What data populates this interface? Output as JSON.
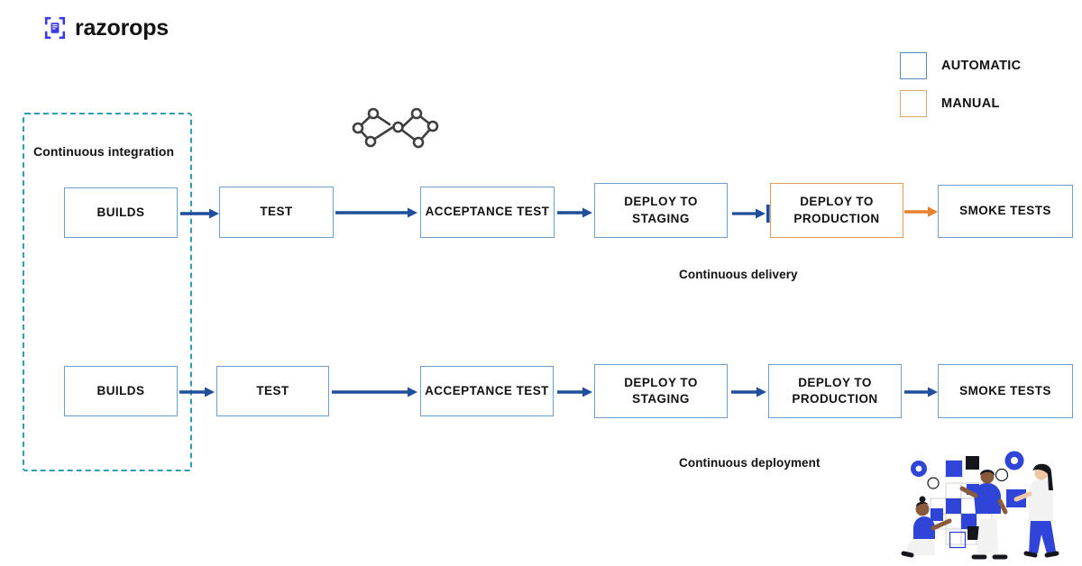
{
  "brand": {
    "name": "razorops",
    "logo_icon": "razorops-bracket-logo",
    "logo_color": "#3b38e8"
  },
  "legend": {
    "items": [
      {
        "label": "AUTOMATIC",
        "color": "#5b87bb",
        "kind": "auto"
      },
      {
        "label": "MANUAL",
        "color": "#dda96f",
        "kind": "manual"
      }
    ]
  },
  "ci_group": {
    "label": "Continuous integration",
    "border_color": "#2e9fb0",
    "style": "dashed"
  },
  "devops_symbol": {
    "icon": "devops-infinity-nodes-icon",
    "color": "#3f3f3f"
  },
  "pipelines": [
    {
      "caption": "Continuous delivery",
      "stages": [
        {
          "label": "BUILDS",
          "kind": "auto"
        },
        {
          "label": "TEST",
          "kind": "auto"
        },
        {
          "label": "ACCEPTANCE TEST",
          "kind": "auto"
        },
        {
          "label": "DEPLOY TO STAGING",
          "kind": "auto"
        },
        {
          "label": "DEPLOY TO PRODUCTION",
          "kind": "manual"
        },
        {
          "label": "SMOKE TESTS",
          "kind": "auto"
        }
      ],
      "connectors": [
        "arrow-blue",
        "arrow-blue",
        "arrow-blue",
        "arrow-blue-gate",
        "arrow-orange"
      ]
    },
    {
      "caption": "Continuous deployment",
      "stages": [
        {
          "label": "BUILDS",
          "kind": "auto"
        },
        {
          "label": "TEST",
          "kind": "auto"
        },
        {
          "label": "ACCEPTANCE TEST",
          "kind": "auto"
        },
        {
          "label": "DEPLOY TO STAGING",
          "kind": "auto"
        },
        {
          "label": "DEPLOY TO PRODUCTION",
          "kind": "auto"
        },
        {
          "label": "SMOKE TESTS",
          "kind": "auto"
        }
      ],
      "connectors": [
        "arrow-blue",
        "arrow-blue",
        "arrow-blue",
        "arrow-blue",
        "arrow-blue"
      ]
    }
  ],
  "colors": {
    "arrow_blue": "#1f4e9c",
    "arrow_orange": "#e8812e",
    "box_blue": "#6f9cc8",
    "box_orange": "#e09a55",
    "teal_dashed": "#2e9fb0",
    "illustration_blue": "#2f45d8"
  },
  "illustration": {
    "icon": "team-building-blocks-illustration",
    "description": "Three people arranging blue and black squares on a grid with gears"
  }
}
